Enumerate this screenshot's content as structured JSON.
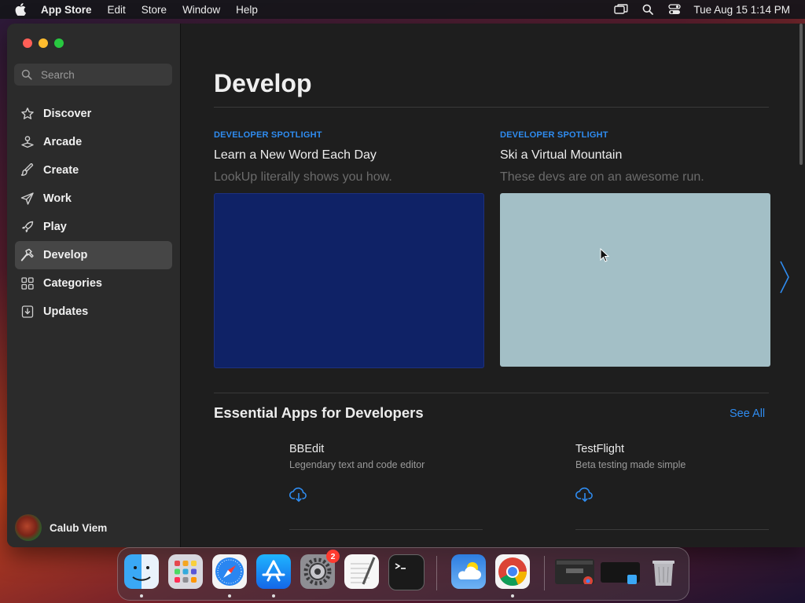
{
  "menubar": {
    "app_name": "App Store",
    "menus": [
      "Edit",
      "Store",
      "Window",
      "Help"
    ],
    "clock": "Tue Aug 15  1:14 PM"
  },
  "sidebar": {
    "search_placeholder": "Search",
    "items": [
      {
        "label": "Discover",
        "icon": "star-icon",
        "active": false
      },
      {
        "label": "Arcade",
        "icon": "joystick-icon",
        "active": false
      },
      {
        "label": "Create",
        "icon": "paintbrush-icon",
        "active": false
      },
      {
        "label": "Work",
        "icon": "paperplane-icon",
        "active": false
      },
      {
        "label": "Play",
        "icon": "rocket-icon",
        "active": false
      },
      {
        "label": "Develop",
        "icon": "hammer-icon",
        "active": true
      },
      {
        "label": "Categories",
        "icon": "grid-icon",
        "active": false
      },
      {
        "label": "Updates",
        "icon": "download-tray-icon",
        "active": false
      }
    ],
    "user_name": "Calub Viem"
  },
  "main": {
    "title": "Develop",
    "spotlights": [
      {
        "eyebrow": "DEVELOPER SPOTLIGHT",
        "title": "Learn a New Word Each Day",
        "subtitle": "LookUp literally shows you how.",
        "card_color": "#0f2266"
      },
      {
        "eyebrow": "DEVELOPER SPOTLIGHT",
        "title": "Ski a Virtual Mountain",
        "subtitle": "These devs are on an awesome run.",
        "card_color": "#a3bfc6"
      }
    ],
    "section_title": "Essential Apps for Developers",
    "see_all": "See All",
    "apps": [
      {
        "name": "BBEdit",
        "description": "Legendary text and code editor"
      },
      {
        "name": "TestFlight",
        "description": "Beta testing made simple"
      }
    ]
  },
  "dock": {
    "apps": [
      "Finder",
      "Launchpad",
      "Safari",
      "App Store",
      "System Settings",
      "TextEdit",
      "Terminal",
      "Weather",
      "Google Chrome",
      "Chrome Window",
      "Finder Window",
      "Trash"
    ],
    "settings_badge": "2"
  },
  "colors": {
    "accent": "#2f8cf0",
    "sidebar_active": "#464646"
  }
}
